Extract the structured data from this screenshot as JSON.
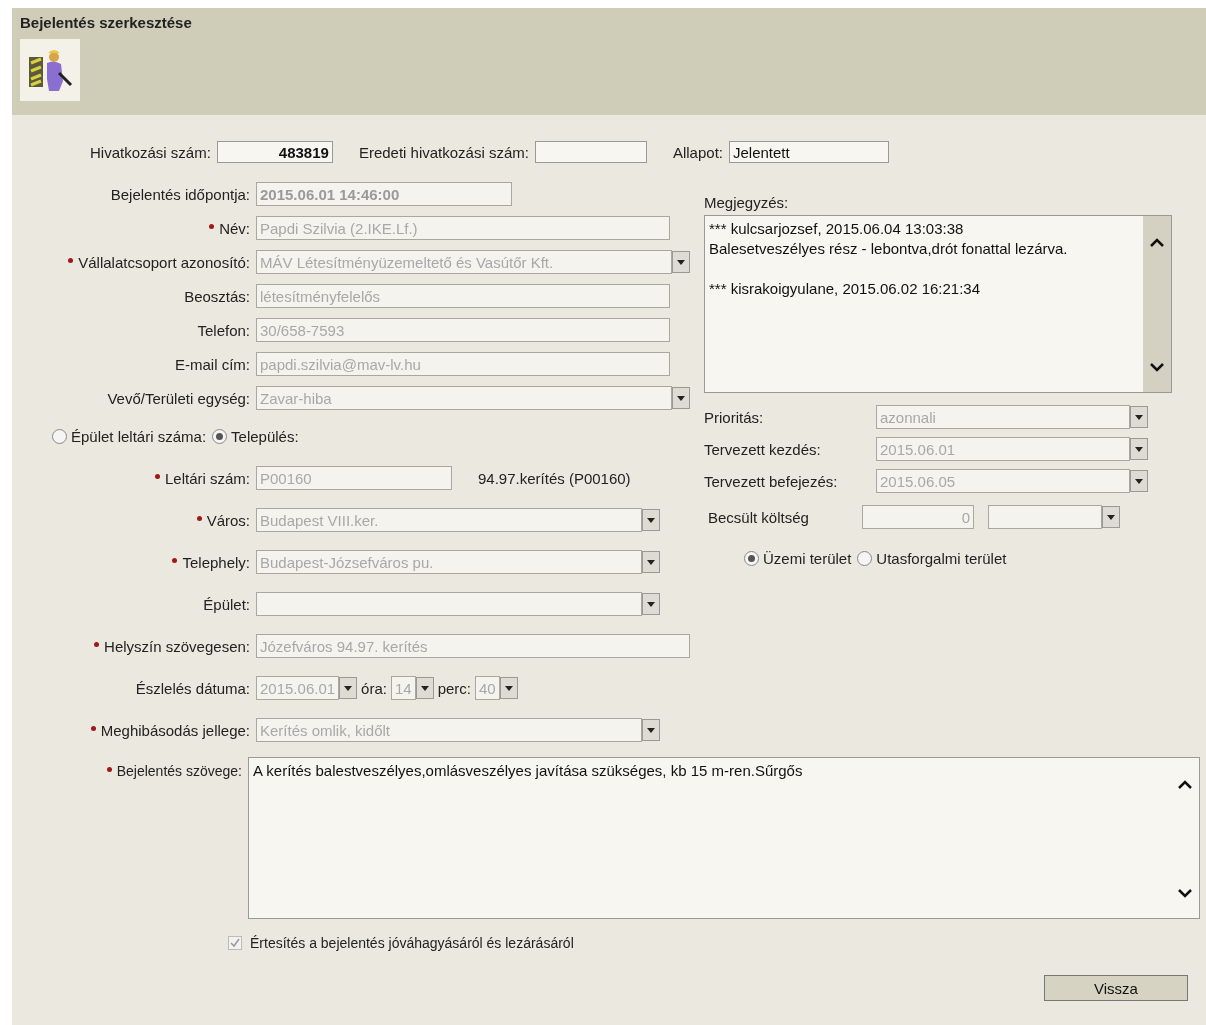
{
  "window": {
    "title": "Bejelentés szerkesztése"
  },
  "reference_fields": [
    {
      "label": "Hivatkozási szám:",
      "value": "483819",
      "kind": "number"
    },
    {
      "label": "Eredeti hivatkozási szám:",
      "kind": "empty"
    },
    {
      "label": "Allapot:",
      "value": "Jelentett",
      "kind": "plain"
    }
  ],
  "reporter_fields": [
    {
      "label": "Bejelentés időpontja:",
      "value": "2015.06.01 14:46:00",
      "required": false,
      "kind": "timestamp"
    },
    {
      "label": "Név:",
      "value": "Papdi Szilvia (2.IKE.Lf.)",
      "required": true,
      "kind": "text"
    },
    {
      "label": "Vállalatcsoport azonosító:",
      "value": "MÁV Létesítményüzemeltető és Vasútőr Kft.",
      "required": true,
      "kind": "select"
    },
    {
      "label": "Beosztás:",
      "value": "létesítményfelelős",
      "required": false,
      "kind": "text"
    },
    {
      "label": "Telefon:",
      "value": "30/658-7593",
      "required": false,
      "kind": "text"
    },
    {
      "label": "E-mail cím:",
      "value": "papdi.szilvia@mav-lv.hu",
      "required": false,
      "kind": "text"
    },
    {
      "label": "Vevő/Területi egység:",
      "value": "Zavar-hiba",
      "required": false,
      "kind": "select"
    }
  ],
  "location_mode": [
    {
      "label": "Épület leltári száma:",
      "selected": false
    },
    {
      "label": "Település:",
      "selected": true
    }
  ],
  "location_fields": [
    {
      "label": "Leltári szám:",
      "value": "P00160",
      "required": true,
      "kind": "short",
      "note": "94.97.kerítés (P00160)"
    },
    {
      "label": "Város:",
      "value": "Budapest VIII.ker.",
      "required": true,
      "kind": "select"
    },
    {
      "label": "Telephely:",
      "value": "Budapest-Józsefváros pu.",
      "required": true,
      "kind": "select"
    },
    {
      "label": "Épület:",
      "required": false,
      "kind": "select"
    },
    {
      "label": "Helyszín szövegesen:",
      "value": "Józefváros 94.97. kerítés",
      "required": true,
      "kind": "wide"
    }
  ],
  "detection": {
    "label": "Észlelés dátuma:",
    "date": "2015.06.01",
    "hour_label": "óra:",
    "hour": "14",
    "minute_label": "perc:",
    "minute": "40"
  },
  "fault_type": {
    "label": "Meghibásodás jellege:",
    "value": "Kerítés omlik, kidőlt",
    "required": true
  },
  "remarks": {
    "label": "Megjegyzés:",
    "entries": [
      [
        "*** kulcsarjozsef, 2015.06.04 13:03:38",
        "Balesetveszélyes rész - lebontva,drót fonattal lezárva."
      ],
      [
        "*** kisrakoigyulane, 2015.06.02 16:21:34"
      ]
    ]
  },
  "planning_fields": [
    {
      "label": "Prioritás:",
      "value": "azonnali"
    },
    {
      "label": "Tervezett kezdés:",
      "value": "2015.06.01"
    },
    {
      "label": "Tervezett befejezés:",
      "value": "2015.06.05"
    }
  ],
  "cost": {
    "label": "Becsült költség",
    "value": "0"
  },
  "area_type": [
    {
      "label": "Üzemi terület",
      "selected": true
    },
    {
      "label": "Utasforgalmi terület",
      "selected": false
    }
  ],
  "description": {
    "label": "Bejelentés szövege:",
    "value": "A kerítés balestveszélyes,omlásveszélyes javítása szükséges, kb 15 m-ren.Sűrgős",
    "required": true
  },
  "notify": {
    "label": "Értesítés a bejelentés jóváhagyásáról és lezárásáról",
    "checked": true
  },
  "buttons": [
    "Vissza"
  ]
}
